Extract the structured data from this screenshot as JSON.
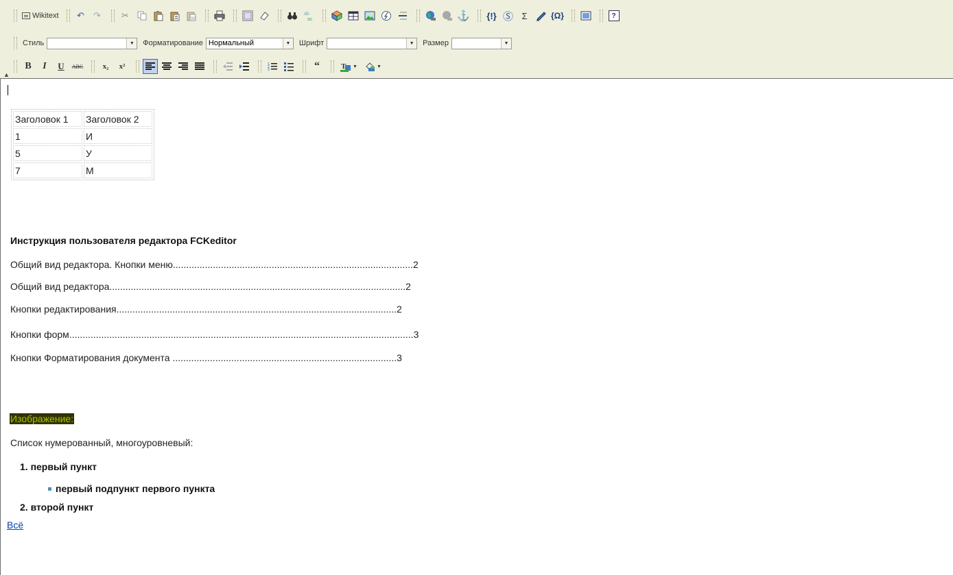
{
  "toolbar": {
    "wikitext_label": "Wikitext",
    "style_label": "Стиль",
    "style_value": "",
    "format_label": "Форматирование",
    "format_value": "Нормальный",
    "font_label": "Шрифт",
    "font_value": "",
    "size_label": "Размер",
    "size_value": "",
    "bold": "B",
    "italic": "I",
    "underline": "U",
    "strike": "ABC",
    "subscript": "x₂",
    "superscript": "x²",
    "sigma": "Σ",
    "help": "?"
  },
  "table": {
    "headers": [
      "Заголовок 1",
      "Заголовок 2"
    ],
    "rows": [
      [
        "1",
        "И"
      ],
      [
        "5",
        "У"
      ],
      [
        "7",
        "М"
      ]
    ]
  },
  "doc": {
    "title": "Инструкция пользователя редактора FCKeditor",
    "toc": [
      "Общий вид редактора. Кнопки меню..........................................................................................2",
      "Общий вид редактора...............................................................................................................2",
      "Кнопки редактирования.........................................................................................................2",
      "Кнопки форм.................................................................................................................................3",
      "Кнопки Форматирования документа ....................................................................................3"
    ],
    "image_label": "Изображение:",
    "list_intro": "Список нумерованный, многоуровневый:",
    "item1": "1.  первый пункт",
    "subitem1": "первый подпункт первого пункта",
    "item2": "2.  второй пункт",
    "link": "Всё"
  },
  "colors": {
    "toolbar_bg": "#efefde",
    "active_button": "#c1d2ee",
    "highlight_bg": "#333300",
    "highlight_text": "#a5c200",
    "link": "#0645ad"
  }
}
